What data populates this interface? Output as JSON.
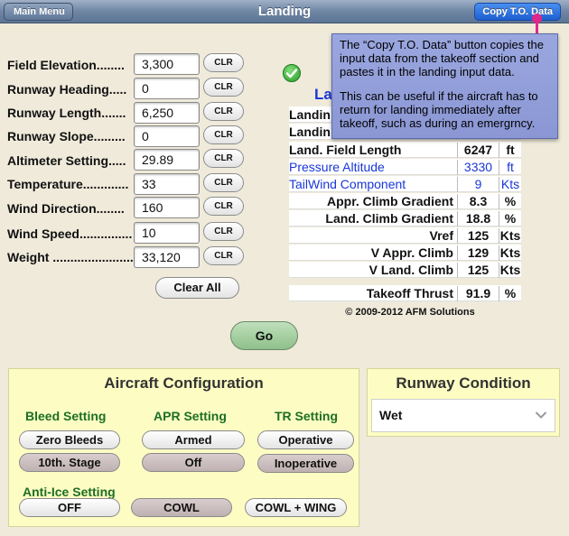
{
  "nav": {
    "title": "Landing",
    "back_label": "Main Menu",
    "copy_label": "Copy T.O. Data"
  },
  "callout": {
    "paragraph1": "The “Copy T.O. Data” button copies the input data from the takeoff section and pastes it in the landing input data.",
    "paragraph2": "This can be useful if the aircraft has to return for landing immediately after takeoff, such as during an emergrncy."
  },
  "inputs": [
    {
      "label": "Field Elevation........",
      "value": "3,300"
    },
    {
      "label": "Runway Heading.....",
      "value": "0"
    },
    {
      "label": "Runway Length.......",
      "value": "6,250"
    },
    {
      "label": "Runway Slope.........",
      "value": "0"
    },
    {
      "label": "Altimeter Setting.....",
      "value": "29.89"
    },
    {
      "label": "Temperature.............",
      "value": "33"
    },
    {
      "label": "Wind Direction........",
      "value": "160"
    },
    {
      "label": "Wind Speed...............",
      "value": "10"
    },
    {
      "label": "Weight .......................",
      "value": "33,120"
    }
  ],
  "clr_label": "CLR",
  "clear_all_label": "Clear All",
  "go_label": "Go",
  "results": {
    "heading_partial": "La",
    "partial_rows": [
      "Landin",
      "Landin"
    ],
    "rows": [
      {
        "label": "Land. Field Length",
        "value": "6247",
        "unit": "ft",
        "style": "bold"
      },
      {
        "label": "Pressure Altitude",
        "value": "3330",
        "unit": "ft",
        "style": "blue"
      },
      {
        "label": "TailWind Component",
        "value": "9",
        "unit": "Kts",
        "style": "blue"
      },
      {
        "label": "Appr. Climb Gradient",
        "value": "8.3",
        "unit": "%",
        "style": "right"
      },
      {
        "label": "Land. Climb Gradient",
        "value": "18.8",
        "unit": "%",
        "style": "right"
      },
      {
        "label": "Vref",
        "value": "125",
        "unit": "Kts",
        "style": "right"
      },
      {
        "label": "V Appr. Climb",
        "value": "129",
        "unit": "Kts",
        "style": "right"
      },
      {
        "label": "V Land. Climb",
        "value": "125",
        "unit": "Kts",
        "style": "right"
      }
    ],
    "thrust": {
      "label": "Takeoff Thrust",
      "value": "91.9",
      "unit": "%"
    },
    "copyright": "© 2009-2012 AFM Solutions"
  },
  "aircraft_config": {
    "title": "Aircraft Configuration",
    "bleed": {
      "label": "Bleed Setting",
      "options": [
        "Zero Bleeds",
        "10th. Stage"
      ],
      "selected": "10th. Stage"
    },
    "apr": {
      "label": "APR Setting",
      "options": [
        "Armed",
        "Off"
      ],
      "selected": "Off"
    },
    "tr": {
      "label": "TR Setting",
      "options": [
        "Operative",
        "Inoperative"
      ],
      "selected": "Inoperative"
    },
    "anti_ice": {
      "label": "Anti-Ice Setting",
      "options": [
        "OFF",
        "COWL",
        "COWL + WING"
      ],
      "selected": "COWL"
    }
  },
  "runway_condition": {
    "title": "Runway Condition",
    "value": "Wet"
  },
  "colors": {
    "background": "#efeada",
    "panel": "#fdfdc3",
    "accent_blue": "#1936d8",
    "group_label_green": "#1d6e25",
    "callout": "#8b97d4"
  }
}
